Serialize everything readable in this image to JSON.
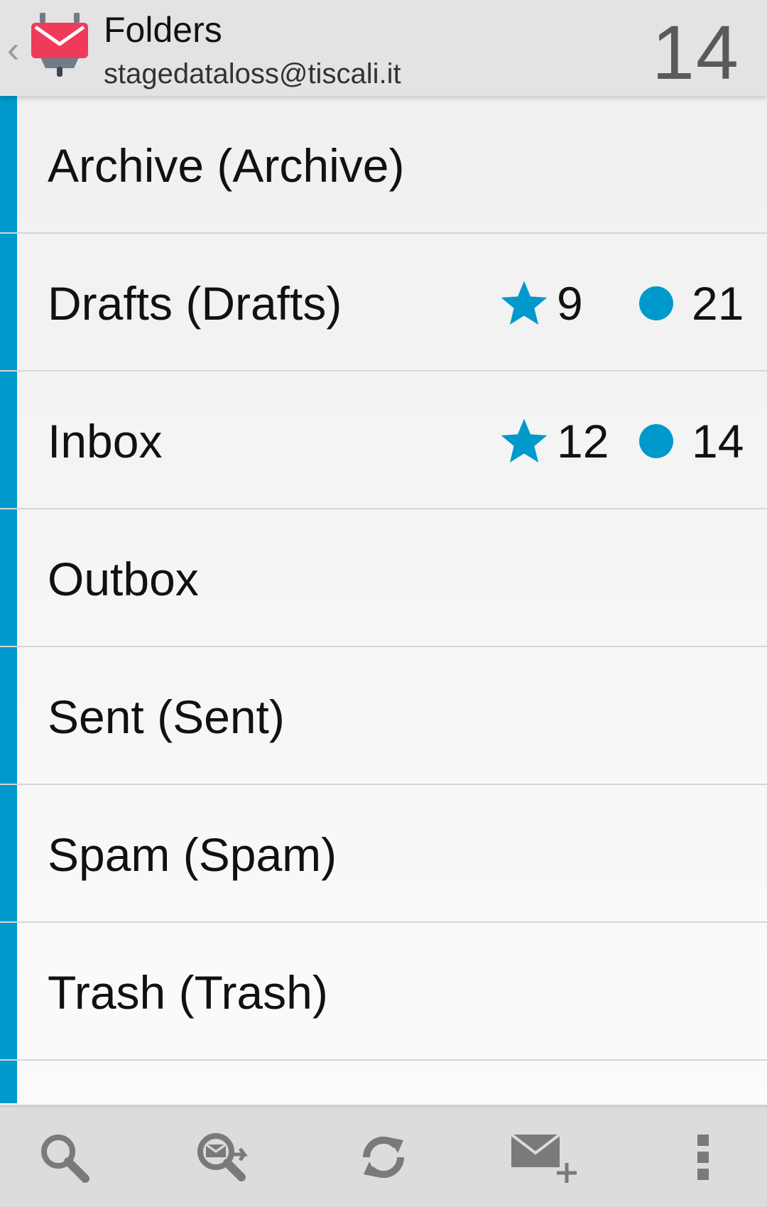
{
  "header": {
    "title": "Folders",
    "account": "stagedataloss@tiscali.it",
    "unread_total": "14"
  },
  "folders": [
    {
      "name": "Archive (Archive)",
      "flagged": "",
      "unread": ""
    },
    {
      "name": "Drafts (Drafts)",
      "flagged": "9",
      "unread": "21"
    },
    {
      "name": "Inbox",
      "flagged": "12",
      "unread": "14"
    },
    {
      "name": "Outbox",
      "flagged": "",
      "unread": ""
    },
    {
      "name": "Sent (Sent)",
      "flagged": "",
      "unread": ""
    },
    {
      "name": "Spam (Spam)",
      "flagged": "",
      "unread": ""
    },
    {
      "name": "Trash (Trash)",
      "flagged": "",
      "unread": ""
    }
  ],
  "toolbar": {
    "icons": [
      "search-icon",
      "search-remote-icon",
      "refresh-icon",
      "compose-icon",
      "overflow-menu-icon"
    ]
  },
  "colors": {
    "accent": "#0099cc",
    "app_icon_red": "#ef3b5a",
    "header_bg": "#e3e3e3",
    "toolbar_bg": "#dcdcdc"
  }
}
